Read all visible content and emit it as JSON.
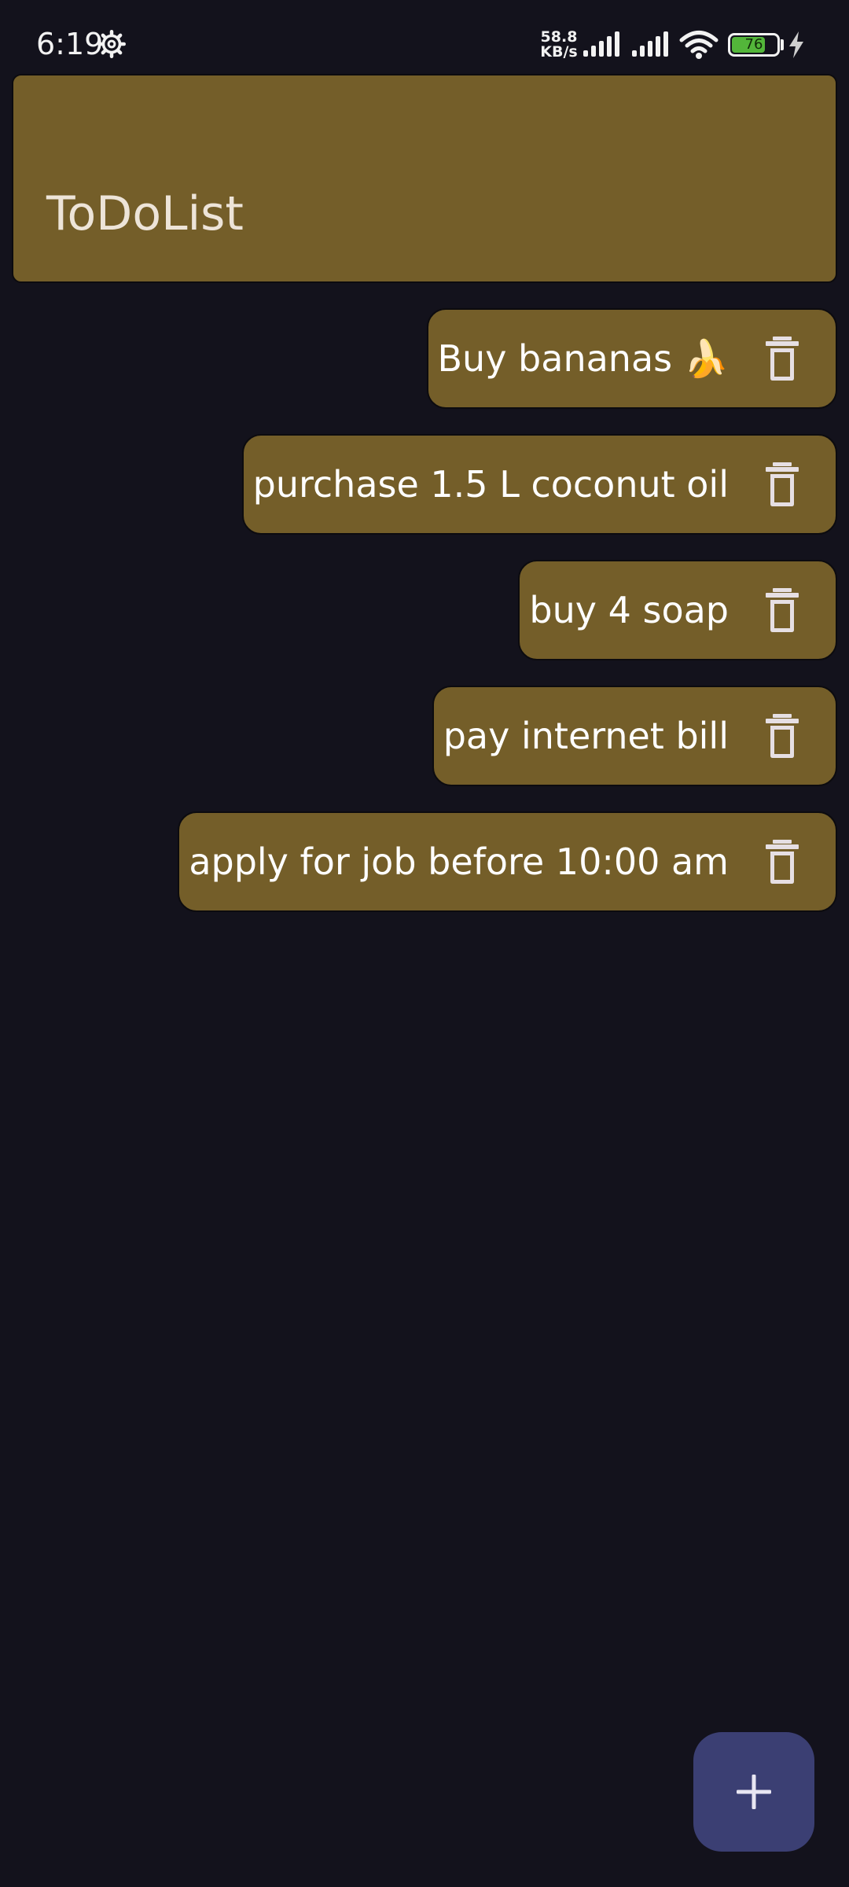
{
  "status_bar": {
    "time": "6:19",
    "network_speed_value": "58.8",
    "network_speed_unit": "KB/s",
    "battery_level": "76",
    "icons": [
      "gear-icon",
      "signal-icon",
      "signal-icon",
      "wifi-icon",
      "battery-icon",
      "charging-icon"
    ]
  },
  "app_bar": {
    "title": "ToDoList"
  },
  "todos": [
    {
      "text": "Buy bananas 🍌",
      "delete_icon": "trash-icon"
    },
    {
      "text": "purchase 1.5 L coconut oil",
      "delete_icon": "trash-icon"
    },
    {
      "text": "buy 4 soap",
      "delete_icon": "trash-icon"
    },
    {
      "text": "pay internet bill",
      "delete_icon": "trash-icon"
    },
    {
      "text": "apply for job before 10:00 am",
      "delete_icon": "trash-icon"
    }
  ],
  "fab": {
    "icon": "plus-icon"
  },
  "colors": {
    "background": "#13121c",
    "card": "#745e29",
    "fab": "#3b3f73",
    "text": "#ffffff",
    "battery_green": "#53b63a"
  }
}
